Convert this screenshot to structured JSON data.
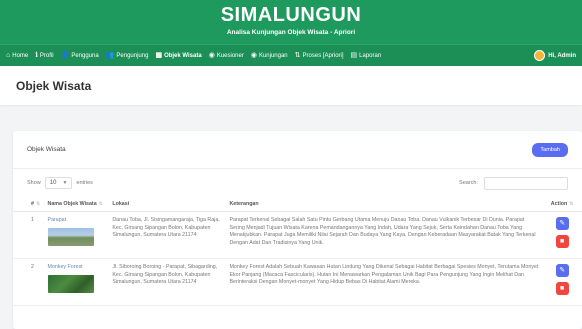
{
  "header": {
    "brand": "SIMALUNGUN",
    "tagline": "Analisa Kunjungan Objek Wisata - Apriori"
  },
  "nav": {
    "items": [
      {
        "label": "Home",
        "icon": "home-icon",
        "glyph": "⌂"
      },
      {
        "label": "Profil",
        "icon": "info-icon",
        "glyph": "ℹ"
      },
      {
        "label": "Pengguna",
        "icon": "user-icon",
        "glyph": "👤"
      },
      {
        "label": "Pengunjung",
        "icon": "users-icon",
        "glyph": "👥"
      },
      {
        "label": "Objek Wisata",
        "icon": "map-icon",
        "glyph": "▦"
      },
      {
        "label": "Kuesioner",
        "icon": "pin-icon",
        "glyph": "◉"
      },
      {
        "label": "Kunjungan",
        "icon": "pin-icon",
        "glyph": "◉"
      },
      {
        "label": "Proses [Apriori]",
        "icon": "sort-icon",
        "glyph": "⇅"
      },
      {
        "label": "Laporan",
        "icon": "report-icon",
        "glyph": "▤"
      }
    ],
    "active": "Objek Wisata",
    "user_label": "Hi, Admin"
  },
  "page": {
    "title": "Objek Wisata"
  },
  "card": {
    "title": "Objek Wisata",
    "add_button": "Tambah"
  },
  "table_controls": {
    "show_label": "Show",
    "entries_value": "10",
    "entries_label": "entries",
    "search_label": "Search:"
  },
  "table": {
    "headers": [
      "#",
      "Nama Objek Wisata",
      "Lokasi",
      "Keterangan",
      "Action"
    ],
    "rows": [
      {
        "no": "1",
        "nama": "Parapat",
        "lokasi": "Danau Toba, Jl. Sisingamangaraja, Tiga Raja, Kec. Girsang Sipangan Bolon, Kabupaten Simalungun, Sumatera Utara 21174",
        "keterangan": "Parapat Terkenal Sebagai Salah Satu Pintu Gerbang Utama Menuju Danau Toba. Danau Vulkanik Terbesar Di Dunia. Parapat Sering Menjadi Tujuan Wisata Karena Pemandangannya Yang Indah, Udara Yang Sejuk, Serta Keindahan Danau Toba Yang Menakjubkan. Parapat Juga Memiliki Nilai Sejarah Dan Budaya Yang Kaya, Dengan Keberadaan Masyarakat Batak Yang Terkenal Dengan Adat Dan Tradisinya Yang Unik."
      },
      {
        "no": "2",
        "nama": "Monkey Forest",
        "lokasi": "Jl. Siboroing Boroing - Parapat, Sibagarding, Kec. Girsang Sipangan Bolon, Kabupaten Simalungun, Sumatera Utara 21174",
        "keterangan": "Monkey Forest Adalah Sebuah Kawasan Hutan Lindung Yang Dikenal Sebagai Habitat Berbagai Spesies Monyet, Terutama Monyet Ekor Panjang (Macaca Fascicularis). Hutan Ini Menawarkan Pengalaman Unik Bagi Para Pengunjung Yang Ingin Melihat Dan Berinteraksi Dengan Monyet-monyet Yang Hidup Bebas Di Habitat Alami Mereka."
      }
    ]
  },
  "colors": {
    "header_green": "#1f9a5e",
    "primary": "#5a6df0",
    "danger": "#f1453d"
  }
}
